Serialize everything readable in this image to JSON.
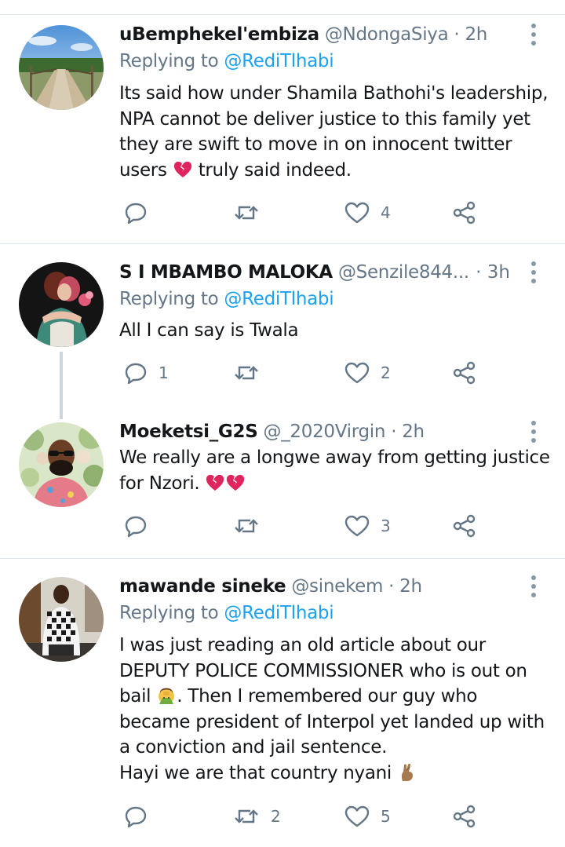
{
  "colors": {
    "link": "#1da1f2",
    "secondary_text": "#657786",
    "primary_text": "#14171a",
    "divider": "#e1e8ed",
    "broken_heart": "#e0245e"
  },
  "tweets": [
    {
      "display_name": "uBemphekel'embiza",
      "handle": "@NdongaSiya",
      "separator": "·",
      "time": "2h",
      "reply_prefix": "Replying to",
      "reply_to": "@RediTlhabi",
      "lines": [
        "Its said how under Shamila Bathohi's leadership,",
        "NPA cannot be deliver justice to this family yet",
        "they are swift to move in on innocent twitter",
        "users",
        "truly said indeed."
      ],
      "emojis": [
        "broken-heart-emoji"
      ],
      "reply_count": "",
      "retweet_count": "",
      "like_count": "4",
      "avatar_icon": "bridge-landscape-avatar"
    },
    {
      "display_name": "S I MBAMBO MALOKA",
      "handle": "@Senzile844...",
      "separator": "·",
      "time": "3h",
      "reply_prefix": "Replying to",
      "reply_to": "@RediTlhabi",
      "lines": [
        "All I can say is Twala"
      ],
      "reply_count": "1",
      "retweet_count": "",
      "like_count": "2",
      "avatar_icon": "hugging-couple-avatar"
    },
    {
      "display_name": "Moeketsi_G2S",
      "handle": "@_2020Virgin",
      "separator": "·",
      "time": "2h",
      "lines": [
        "We really are a longwe away from getting justice",
        "for Nzori."
      ],
      "emojis": [
        "broken-heart-emoji",
        "broken-heart-emoji"
      ],
      "reply_count": "",
      "retweet_count": "",
      "like_count": "3",
      "avatar_icon": "man-sunglasses-avatar"
    },
    {
      "display_name": "mawande sineke",
      "handle": "@sinekem",
      "separator": "·",
      "time": "2h",
      "reply_prefix": "Replying to",
      "reply_to": "@RediTlhabi",
      "lines": [
        "I was just reading an old article about our",
        "DEPUTY POLICE COMMISSIONER who is out on",
        "bail",
        ". Then I remembered our guy who",
        "became president of Interpol yet landed up with",
        "a conviction and jail sentence.",
        "Hayi we are that country nyani"
      ],
      "emojis": [
        "facepalm-emoji",
        "crossed-fingers-emoji"
      ],
      "reply_count": "",
      "retweet_count": "2",
      "like_count": "5",
      "avatar_icon": "man-checkered-shirt-avatar"
    }
  ]
}
